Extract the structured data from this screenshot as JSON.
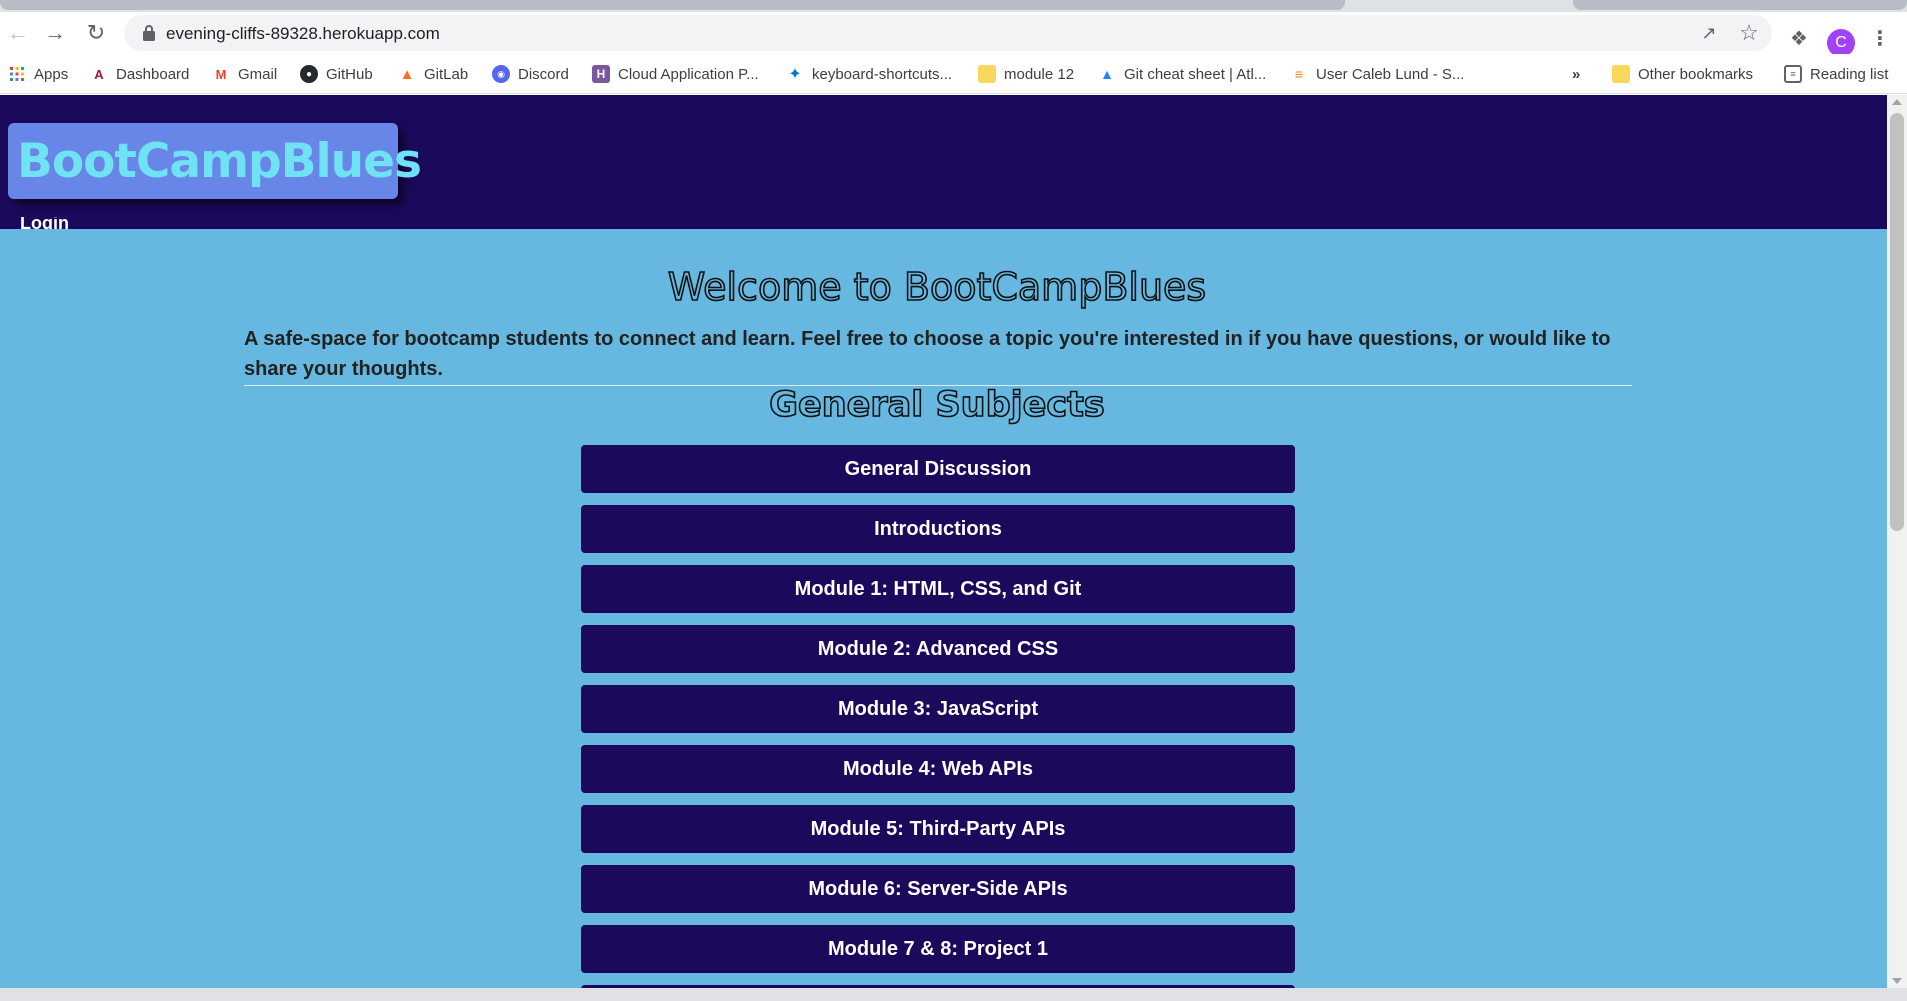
{
  "browser": {
    "url": "evening-cliffs-89328.herokuapp.com",
    "bookmarks": [
      {
        "label": "Apps",
        "icon": "apps-grid-icon"
      },
      {
        "label": "Dashboard",
        "icon": "arizona-logo-icon"
      },
      {
        "label": "Gmail",
        "icon": "gmail-icon"
      },
      {
        "label": "GitHub",
        "icon": "github-icon"
      },
      {
        "label": "GitLab",
        "icon": "gitlab-icon"
      },
      {
        "label": "Discord",
        "icon": "discord-icon"
      },
      {
        "label": "Cloud Application P...",
        "icon": "heroku-icon"
      },
      {
        "label": "keyboard-shortcuts...",
        "icon": "vscode-icon"
      },
      {
        "label": "module 12",
        "icon": "folder-icon"
      },
      {
        "label": "Git cheat sheet | Atl...",
        "icon": "atlassian-icon"
      },
      {
        "label": "User Caleb Lund - S...",
        "icon": "stackoverflow-icon"
      }
    ],
    "overflow_label": "»",
    "other_bookmarks": "Other bookmarks",
    "reading_list": "Reading list",
    "profile_initial": "C"
  },
  "site": {
    "logo": "BootCampBlues",
    "login": "Login",
    "welcome_title": "Welcome to BootCampBlues",
    "tagline": "A safe-space for bootcamp students to connect and learn. Feel free to choose a topic you're interested in if you have questions, or would like to share your thoughts.",
    "subjects_title": "General Subjects",
    "subjects": [
      "General Discussion",
      "Introductions",
      "Module 1: HTML, CSS, and Git",
      "Module 2: Advanced CSS",
      "Module 3: JavaScript",
      "Module 4: Web APIs",
      "Module 5: Third-Party APIs",
      "Module 6: Server-Side APIs",
      "Module 7 & 8: Project 1"
    ]
  },
  "colors": {
    "header_bg": "#1b0a5c",
    "page_bg": "#67b8e0",
    "logo_bg": "#6886e8",
    "logo_text": "#6fe3f3",
    "button_bg": "#1b0a5c"
  }
}
